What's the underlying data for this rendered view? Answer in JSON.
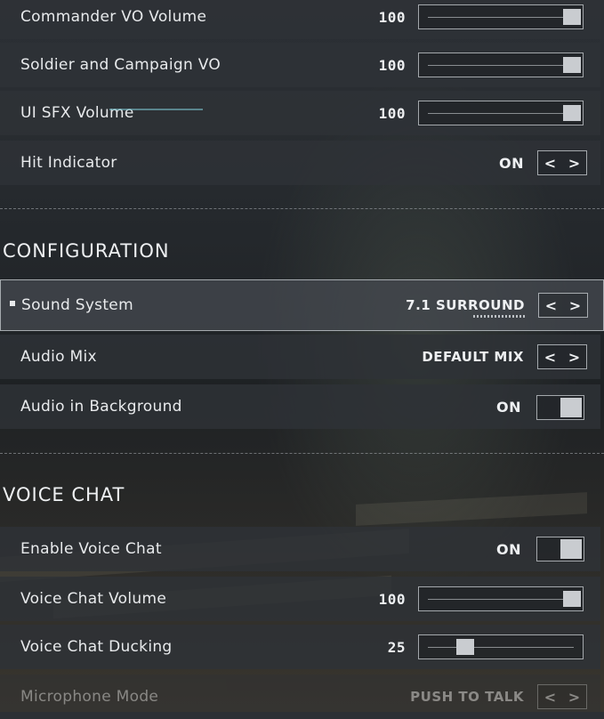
{
  "audio_rows": [
    {
      "label": "Commander VO Volume",
      "value": "100",
      "level": 100
    },
    {
      "label": "Soldier and Campaign VO",
      "value": "100",
      "level": 100
    },
    {
      "label": "UI SFX Volume",
      "value": "100",
      "level": 100
    },
    {
      "label": "Hit Indicator",
      "value": "ON"
    }
  ],
  "configuration": {
    "title": "CONFIGURATION",
    "sound_system": {
      "label": "Sound System",
      "value": "7.1 SURROUND"
    },
    "audio_mix": {
      "label": "Audio Mix",
      "value": "DEFAULT MIX"
    },
    "audio_background": {
      "label": "Audio in Background",
      "value": "ON"
    }
  },
  "voice_chat": {
    "title": "VOICE CHAT",
    "enable": {
      "label": "Enable Voice Chat",
      "value": "ON"
    },
    "volume": {
      "label": "Voice Chat Volume",
      "value": "100",
      "level": 100
    },
    "ducking": {
      "label": "Voice Chat Ducking",
      "value": "25",
      "level": 25
    },
    "mic_mode": {
      "label": "Microphone Mode",
      "value": "PUSH TO TALK"
    }
  },
  "glyphs": {
    "prev": "<",
    "next": ">"
  }
}
